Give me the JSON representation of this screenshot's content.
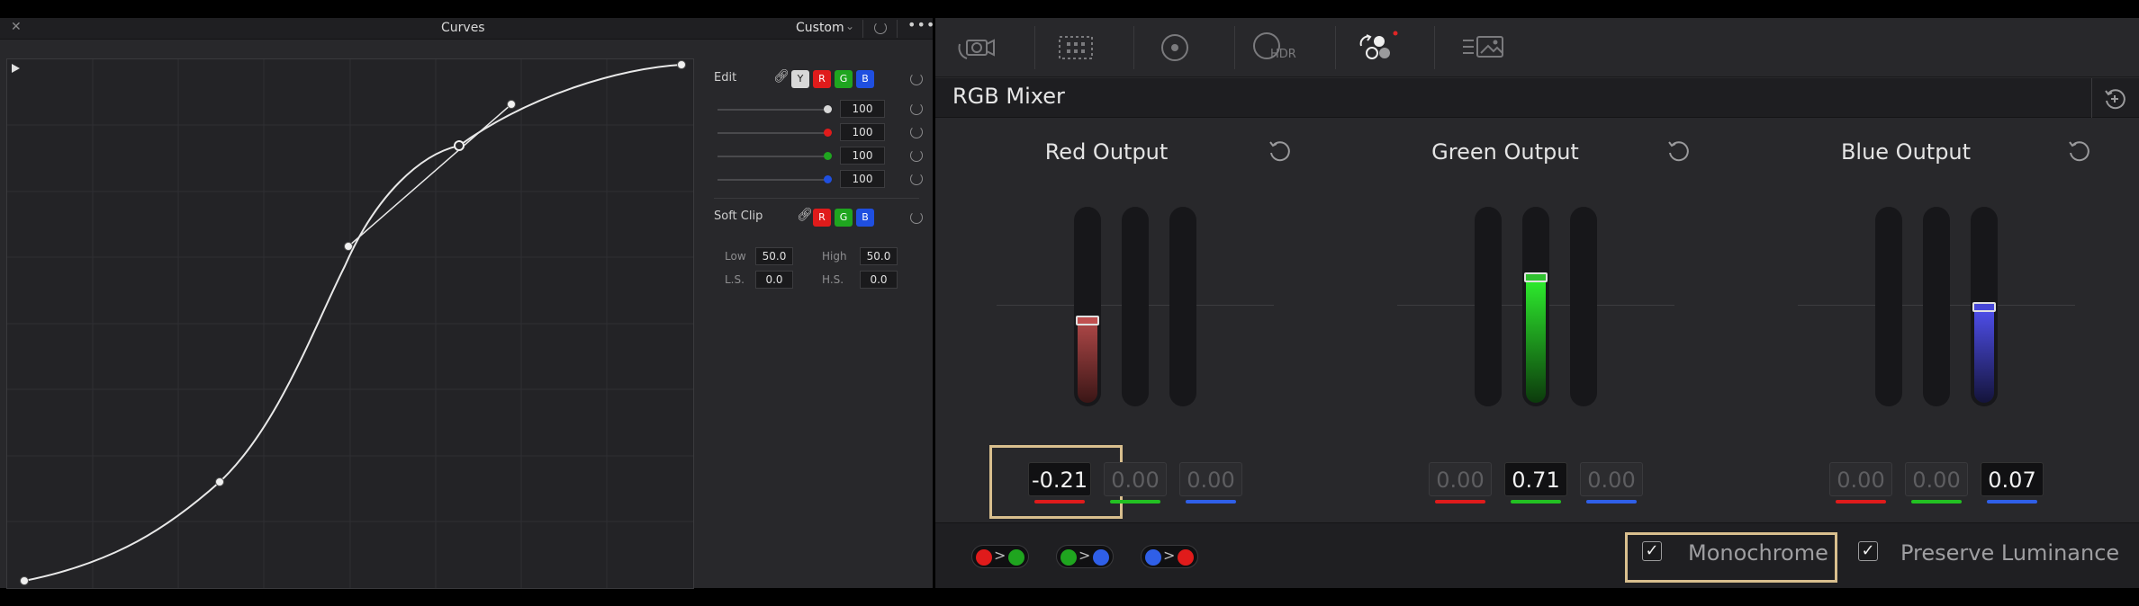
{
  "curves": {
    "title": "Curves",
    "mode": "Custom",
    "edit_label": "Edit",
    "channel_chips": [
      {
        "label": "Y",
        "color": "#d8d8d8"
      },
      {
        "label": "R",
        "color": "#e01b1b"
      },
      {
        "label": "G",
        "color": "#1fa51f"
      },
      {
        "label": "B",
        "color": "#1f4fe0"
      }
    ],
    "intensity_rows": [
      {
        "value": "100",
        "color": "#d8d8d8"
      },
      {
        "value": "100",
        "color": "#e01b1b"
      },
      {
        "value": "100",
        "color": "#1fa51f"
      },
      {
        "value": "100",
        "color": "#1f4fe0"
      }
    ],
    "soft_clip_label": "Soft Clip",
    "softclip_chips": [
      "R",
      "G",
      "B"
    ],
    "low_label": "Low",
    "low_value": "50.0",
    "high_label": "High",
    "high_value": "50.0",
    "ls_label": "L.S.",
    "ls_value": "0.0",
    "hs_label": "H.S.",
    "hs_value": "0.0"
  },
  "mixer": {
    "title": "RGB Mixer",
    "toolbar_icons": [
      "camera-raw-icon",
      "color-match-icon",
      "color-wheels-icon",
      "hdr-icon",
      "rgb-mixer-icon",
      "motion-effects-icon"
    ],
    "hdr_label": "HDR",
    "outputs": [
      {
        "title": "Red Output",
        "levels": [
          -0.21,
          0,
          0
        ],
        "values": [
          "-0.21",
          "0.00",
          "0.00"
        ],
        "active": 0
      },
      {
        "title": "Green Output",
        "levels": [
          0,
          0.71,
          0
        ],
        "values": [
          "0.00",
          "0.71",
          "0.00"
        ],
        "active": 1
      },
      {
        "title": "Blue Output",
        "levels": [
          0,
          0,
          0.07
        ],
        "values": [
          "0.00",
          "0.00",
          "0.07"
        ],
        "active": 2
      }
    ],
    "monochrome": {
      "label": "Monochrome",
      "checked": true
    },
    "preserve_luminance": {
      "label": "Preserve Luminance",
      "checked": true
    },
    "colors": {
      "red": "#e01b1b",
      "green": "#22c022",
      "blue": "#2f5fe8",
      "highlight": "#d9bf8e"
    }
  }
}
